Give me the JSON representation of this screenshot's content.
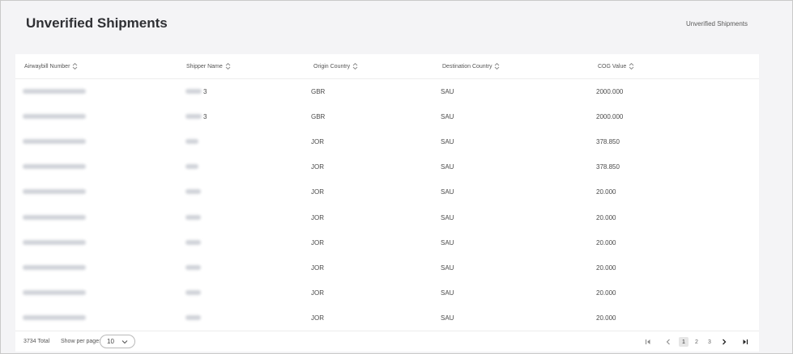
{
  "page": {
    "title": "Unverified Shipments",
    "breadcrumb": "Unverified Shipments"
  },
  "table": {
    "columns": [
      {
        "key": "awb",
        "label": "Airwaybill Number"
      },
      {
        "key": "shipper",
        "label": "Shipper Name"
      },
      {
        "key": "origin",
        "label": "Origin Country"
      },
      {
        "key": "destination",
        "label": "Destination Country"
      },
      {
        "key": "cog",
        "label": "COG Value"
      }
    ],
    "rows": [
      {
        "shipper_suffix": "3",
        "origin": "GBR",
        "destination": "SAU",
        "cog": "2000.000"
      },
      {
        "shipper_suffix": "3",
        "origin": "GBR",
        "destination": "SAU",
        "cog": "2000.000"
      },
      {
        "shipper_suffix": "",
        "origin": "JOR",
        "destination": "SAU",
        "cog": "378.850"
      },
      {
        "shipper_suffix": "",
        "origin": "JOR",
        "destination": "SAU",
        "cog": "378.850"
      },
      {
        "shipper_suffix": "",
        "origin": "JOR",
        "destination": "SAU",
        "cog": "20.000"
      },
      {
        "shipper_suffix": "",
        "origin": "JOR",
        "destination": "SAU",
        "cog": "20.000"
      },
      {
        "shipper_suffix": "",
        "origin": "JOR",
        "destination": "SAU",
        "cog": "20.000"
      },
      {
        "shipper_suffix": "",
        "origin": "JOR",
        "destination": "SAU",
        "cog": "20.000"
      },
      {
        "shipper_suffix": "",
        "origin": "JOR",
        "destination": "SAU",
        "cog": "20.000"
      },
      {
        "shipper_suffix": "",
        "origin": "JOR",
        "destination": "SAU",
        "cog": "20.000"
      }
    ]
  },
  "footer": {
    "total": "3734 Total",
    "per_page_label": "Show per page:",
    "per_page_value": "10",
    "pages": [
      "1",
      "2",
      "3"
    ],
    "current_page": "1"
  },
  "icons": {
    "sort": "sort-icon",
    "first": "first-page-icon",
    "prev": "chevron-left-icon",
    "next": "chevron-right-icon",
    "last": "last-page-icon",
    "dropdown": "chevron-down-icon"
  },
  "colors": {
    "background": "#f4f4f6",
    "card": "#ffffff",
    "redacted": "#c9ccd3"
  }
}
